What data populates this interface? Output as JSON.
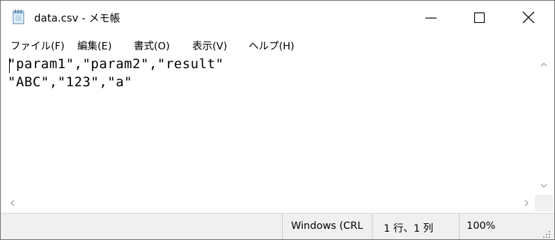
{
  "window": {
    "title": "data.csv - メモ帳"
  },
  "menu": [
    {
      "label": "ファイル(F)"
    },
    {
      "label": "編集(E)"
    },
    {
      "label": "書式(O)"
    },
    {
      "label": "表示(V)"
    },
    {
      "label": "ヘルプ(H)"
    }
  ],
  "editor": {
    "lines": [
      "\"param1\",\"param2\",\"result\"",
      "\"ABC\",\"123\",\"a\""
    ]
  },
  "status": {
    "encoding": "Windows (CRL",
    "position": "1 行、1 列",
    "zoom": "100%"
  },
  "icons": {
    "app": "notepad-icon",
    "minimize": "minimize-icon",
    "maximize": "maximize-icon",
    "close": "close-icon"
  }
}
